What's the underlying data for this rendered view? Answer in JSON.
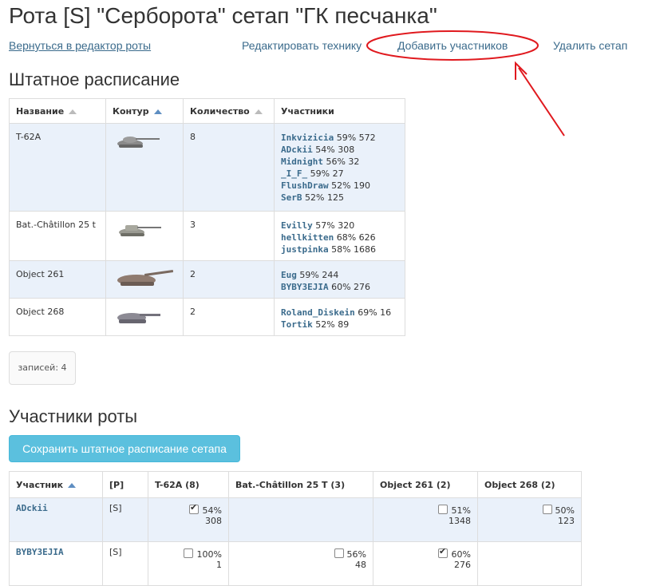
{
  "page_title": "Рота [S] \"Серборота\" сетап \"ГК песчанка\"",
  "links": {
    "back": "Вернуться в редактор роты",
    "edit_tech": "Редактировать технику",
    "add_members": "Добавить участников",
    "delete_setup": "Удалить сетап"
  },
  "staff_section": {
    "heading": "Штатное расписание",
    "columns": [
      "Название",
      "Контур",
      "Количество",
      "Участники"
    ],
    "rows": [
      {
        "name": "T-62A",
        "qty": "8",
        "players": [
          {
            "name": "Inkvizicia",
            "stat": " 59% 572"
          },
          {
            "name": "ADckii",
            "stat": " 54% 308"
          },
          {
            "name": "Midnight",
            "stat": " 56% 32"
          },
          {
            "name": "_I_F_",
            "stat": " 59% 27"
          },
          {
            "name": "FlushDraw",
            "stat": " 52% 190"
          },
          {
            "name": "SerB",
            "stat": " 52% 125"
          }
        ]
      },
      {
        "name": "Bat.-Châtillon 25 t",
        "qty": "3",
        "players": [
          {
            "name": "Evilly",
            "stat": " 57% 320"
          },
          {
            "name": "hellkitten",
            "stat": " 68% 626"
          },
          {
            "name": "justpinka",
            "stat": " 58% 1686"
          }
        ]
      },
      {
        "name": "Object 261",
        "qty": "2",
        "players": [
          {
            "name": "Eug",
            "stat": " 59% 244"
          },
          {
            "name": "BYBY3EJIA",
            "stat": " 60% 276"
          }
        ]
      },
      {
        "name": "Object 268",
        "qty": "2",
        "players": [
          {
            "name": "Roland_Diskein",
            "stat": " 69% 16"
          },
          {
            "name": "Tortik",
            "stat": " 52% 89"
          }
        ]
      }
    ],
    "records": "записей: 4"
  },
  "members_section": {
    "heading": "Участники роты",
    "save_button": "Сохранить штатное расписание сетапа",
    "columns": [
      "Участник",
      "[P]",
      "T-62A (8)",
      "Bat.-Châtillon 25 T (3)",
      "Object 261 (2)",
      "Object 268 (2)"
    ],
    "rows": [
      {
        "name": "ADckii",
        "role": "[S]",
        "t62": {
          "checked": true,
          "pct": "54%",
          "battles": "308"
        },
        "bat": null,
        "o261": {
          "checked": false,
          "pct": "51%",
          "battles": "1348"
        },
        "o268": {
          "checked": false,
          "pct": "50%",
          "battles": "123"
        }
      },
      {
        "name": "BYBY3EJIA",
        "role": "[S]",
        "t62": {
          "checked": false,
          "pct": "100%",
          "battles": "1"
        },
        "bat": {
          "checked": false,
          "pct": "56%",
          "battles": "48"
        },
        "o261": {
          "checked": true,
          "pct": "60%",
          "battles": "276"
        },
        "o268": null
      }
    ]
  },
  "colors": {
    "link": "#3b6b8c",
    "button": "#5bc0de",
    "highlight_row": "#eaf1fa",
    "annotation": "#e0191e"
  }
}
